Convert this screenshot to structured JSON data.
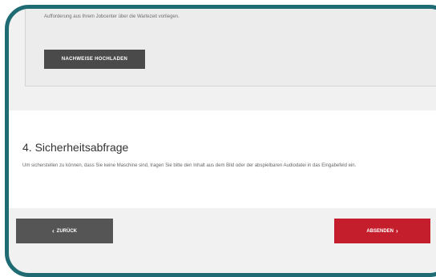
{
  "upload": {
    "text": "Aufforderung aus Ihrem Jobcenter über die Wartezeit vorliegen.",
    "button_label": "NACHWEISE HOCHLADEN"
  },
  "security_section": {
    "title": "4. Sicherheitsabfrage",
    "description": "Um sicherstellen zu können, dass Sie keine Maschine sind, tragen Sie bitte den Inhalt aus dem Bild oder der abspielbaren Audiodatei in das Eingabefeld ein."
  },
  "nav": {
    "back_label": "ZURÜCK",
    "back_icon": "‹",
    "next_label": "ABSENDEN",
    "next_icon": "›"
  },
  "colors": {
    "frame": "#1e6b73",
    "accent": "#c41e2d",
    "dark_button": "#4a4a4a"
  }
}
